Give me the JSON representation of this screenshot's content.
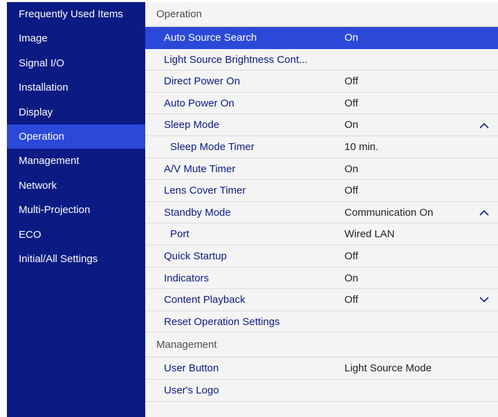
{
  "sidebar": {
    "items": [
      {
        "label": "Frequently Used Items"
      },
      {
        "label": "Image"
      },
      {
        "label": "Signal I/O"
      },
      {
        "label": "Installation"
      },
      {
        "label": "Display"
      },
      {
        "label": "Operation"
      },
      {
        "label": "Management"
      },
      {
        "label": "Network"
      },
      {
        "label": "Multi-Projection"
      },
      {
        "label": "ECO"
      },
      {
        "label": "Initial/All Settings"
      }
    ],
    "active_index": 5
  },
  "operation": {
    "title": "Operation",
    "rows": [
      {
        "label": "Auto Source Search",
        "value": "On"
      },
      {
        "label": "Light Source Brightness Cont...",
        "value": ""
      },
      {
        "label": "Direct Power On",
        "value": "Off"
      },
      {
        "label": "Auto Power On",
        "value": "Off"
      },
      {
        "label": "Sleep Mode",
        "value": "On",
        "expander": "chevron-up-icon"
      },
      {
        "label": "Sleep Mode Timer",
        "value": "10 min."
      },
      {
        "label": "A/V Mute Timer",
        "value": "On"
      },
      {
        "label": "Lens Cover Timer",
        "value": "Off"
      },
      {
        "label": "Standby Mode",
        "value": "Communication On",
        "expander": "chevron-up-icon"
      },
      {
        "label": "Port",
        "value": "Wired LAN"
      },
      {
        "label": "Quick Startup",
        "value": "Off"
      },
      {
        "label": "Indicators",
        "value": "On"
      },
      {
        "label": "Content Playback",
        "value": "Off",
        "expander": "chevron-down-icon"
      },
      {
        "label": "Reset Operation Settings",
        "value": ""
      }
    ]
  },
  "management": {
    "title": "Management",
    "rows": [
      {
        "label": "User Button",
        "value": "Light Source Mode"
      },
      {
        "label": "User's Logo",
        "value": ""
      }
    ]
  },
  "colors": {
    "sidebar_bg": "#0c1b84",
    "selection": "#2b49d8",
    "menu_text": "#0c1b84",
    "panel_bg": "#f4f4f4"
  }
}
